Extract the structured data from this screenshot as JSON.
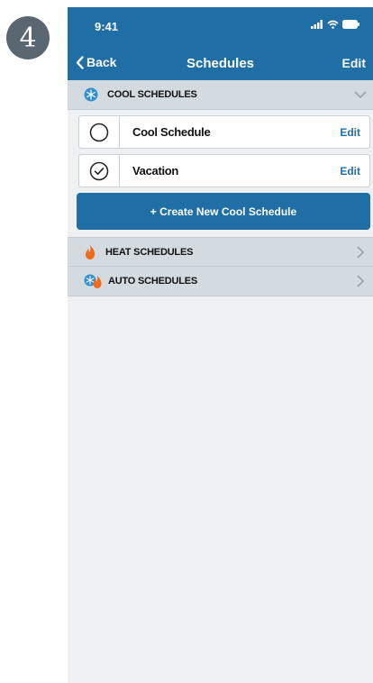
{
  "step": {
    "number": "4"
  },
  "status_bar": {
    "time": "9:41",
    "icons": [
      "signal-icon",
      "wifi-icon",
      "battery-icon"
    ]
  },
  "nav": {
    "back_label": "Back",
    "title": "Schedules",
    "edit_label": "Edit"
  },
  "sections": {
    "cool": {
      "label": "COOL SCHEDULES",
      "icon": "snowflake-icon",
      "expanded": true
    },
    "heat": {
      "label": "HEAT SCHEDULES",
      "icon": "flame-icon",
      "expanded": false
    },
    "auto": {
      "label": "AUTO SCHEDULES",
      "icon": "auto-icon",
      "expanded": false
    }
  },
  "cool_schedules": [
    {
      "name": "Cool Schedule",
      "selected": false,
      "edit_label": "Edit"
    },
    {
      "name": "Vacation",
      "selected": true,
      "edit_label": "Edit"
    }
  ],
  "create_button_label": "+ Create New Cool Schedule",
  "colors": {
    "accent": "#1f6fa6",
    "section_bg": "#d3dae0",
    "flame": "#f26b1d",
    "snowflake": "#2f8fd0"
  }
}
